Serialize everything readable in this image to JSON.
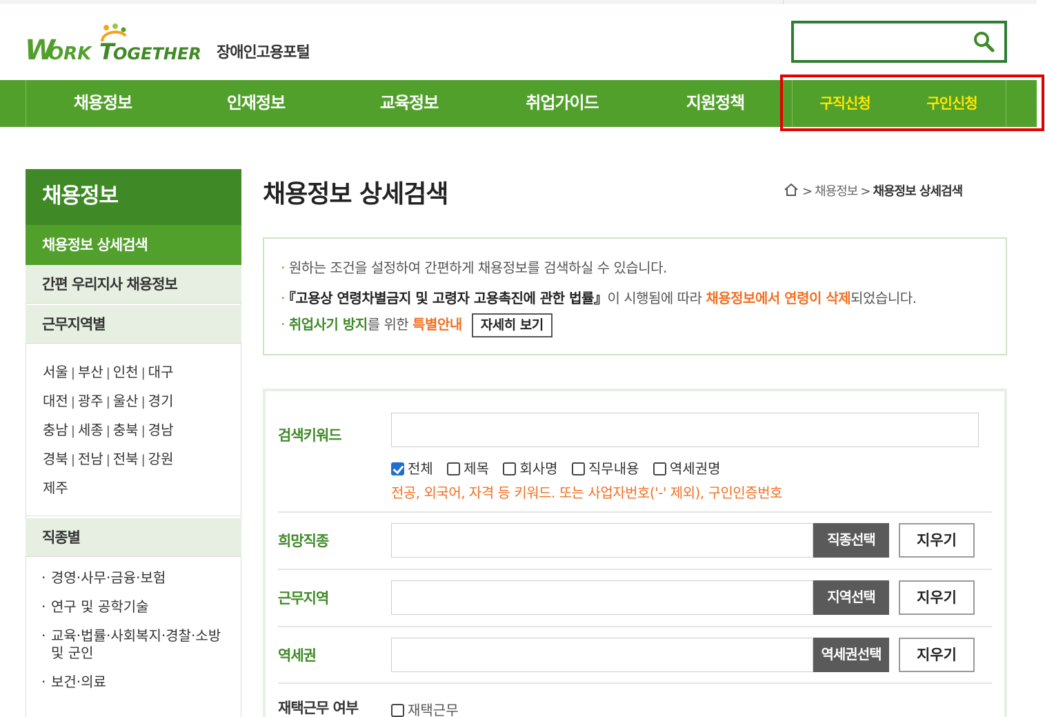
{
  "header": {
    "logo_text": "WORK TOGETHER",
    "logo_sub": "장애인고용포털",
    "search": {
      "value": "",
      "placeholder": ""
    }
  },
  "gnb": {
    "items": [
      "채용정보",
      "인재정보",
      "교육정보",
      "취업가이드",
      "지원정책"
    ],
    "sub_items": [
      "구직신청",
      "구인신청"
    ]
  },
  "sidebar": {
    "title": "채용정보",
    "active": "채용정보 상세검색",
    "menu": [
      "간편 우리지사 채용정보",
      "근무지역별"
    ],
    "regions": [
      [
        "서울",
        "부산",
        "인천",
        "대구"
      ],
      [
        "대전",
        "광주",
        "울산",
        "경기"
      ],
      [
        "충남",
        "세종",
        "충북",
        "경남"
      ],
      [
        "경북",
        "전남",
        "전북",
        "강원"
      ],
      [
        "제주"
      ]
    ],
    "job_section": "직종별",
    "jobs": [
      "경영·사무·금융·보험",
      "연구 및 공학기술",
      "교육·법률·사회복지·경찰·소방 및 군인",
      "보건·의료"
    ]
  },
  "main": {
    "title": "채용정보 상세검색",
    "breadcrumb": [
      "채용정보",
      "채용정보 상세검색"
    ],
    "notice": {
      "line1": "원하는 조건을 설정하여 간편하게 채용정보를 검색하실 수 있습니다.",
      "line2_bold": "『고용상 연령차별금지 및 고령자 고용촉진에 관한 법률』",
      "line2_mid": "이 시행됨에 따라 ",
      "line2_orange": "채용정보에서 연령이 삭제",
      "line2_end": "되었습니다.",
      "line3_green": "취업사기 방지",
      "line3_mid": "를 위한 ",
      "line3_orange": "특별안내",
      "more_button": "자세히 보기"
    },
    "form": {
      "keyword_label": "검색키워드",
      "keyword_value": "",
      "keyword_options": [
        {
          "label": "전체",
          "checked": true
        },
        {
          "label": "제목",
          "checked": false
        },
        {
          "label": "회사명",
          "checked": false
        },
        {
          "label": "직무내용",
          "checked": false
        },
        {
          "label": "역세권명",
          "checked": false
        }
      ],
      "keyword_hint": "전공, 외국어, 자격 등 키워드. 또는 사업자번호('-' 제외), 구인인증번호",
      "job_label": "희망직종",
      "job_button": "직종선택",
      "region_label": "근무지역",
      "region_button": "지역선택",
      "station_label": "역세권",
      "station_button": "역세권선택",
      "clear_label": "지우기",
      "telework_label": "재택근무 여부",
      "telework_option": "재택근무"
    }
  },
  "colors": {
    "brand_green": "#51a02b",
    "dark_green": "#3f8a27",
    "highlight": "#ffe600",
    "accent_orange": "#f36f21",
    "annotation_red": "#e30000"
  }
}
